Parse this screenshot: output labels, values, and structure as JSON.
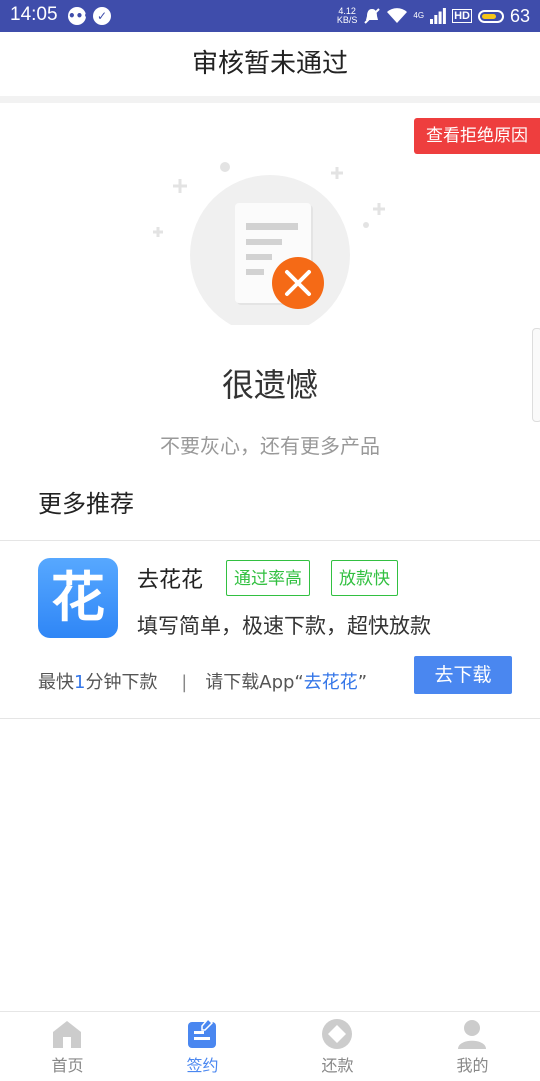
{
  "status_bar": {
    "time": "14:05",
    "speed_value": "4.12",
    "speed_unit": "KB/S",
    "net_type": "4G",
    "hd": "HD",
    "battery": "63"
  },
  "header": {
    "title": "审核暂未通过"
  },
  "reject_reason_button": "查看拒绝原因",
  "result": {
    "title": "很遗憾",
    "subtitle": "不要灰心，还有更多产品"
  },
  "more": {
    "title": "更多推荐",
    "product": {
      "icon_char": "花",
      "name": "去花花",
      "tags": [
        "通过率高",
        "放款快"
      ],
      "description": "填写简单，极速下款，超快放款",
      "footer_prefix": "最快",
      "footer_number": "1",
      "footer_unit": "分钟下款",
      "footer_sep": "|",
      "footer_text": "请下载App“",
      "footer_app": "去花花",
      "footer_close": "”",
      "button": "去下载"
    }
  },
  "tabbar": {
    "items": [
      {
        "label": "首页",
        "icon": "home-icon"
      },
      {
        "label": "签约",
        "icon": "contract-icon"
      },
      {
        "label": "还款",
        "icon": "repay-icon"
      },
      {
        "label": "我的",
        "icon": "profile-icon"
      }
    ],
    "active_index": 1
  },
  "colors": {
    "status_bar": "#3f4dab",
    "accent": "#4a87f0",
    "danger": "#ee3e3e",
    "tag_green": "#32c041"
  }
}
